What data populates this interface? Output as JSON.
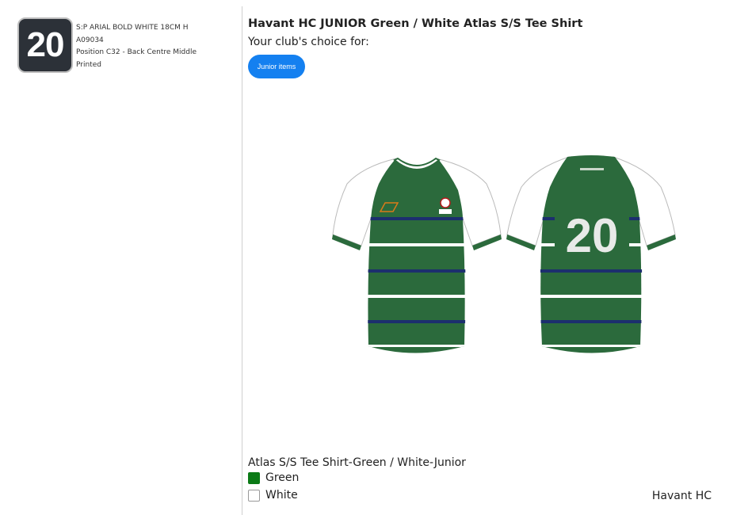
{
  "number_preview": {
    "number": "20",
    "spec_lines": [
      "S:P ARIAL BOLD WHITE 18CM H",
      "A09034",
      "Position C32 - Back Centre Middle",
      "Printed"
    ]
  },
  "product": {
    "title": "Havant HC JUNIOR Green / White Atlas S/S Tee Shirt",
    "subtitle": "Your club's choice for:",
    "category_button": "Junior items",
    "variant_name": "Atlas S/S Tee Shirt-Green / White-Junior",
    "shirt_back_number": "20",
    "colours": [
      {
        "label": "Green",
        "swatch": "#0b7a16"
      },
      {
        "label": "White",
        "swatch": "#ffffff"
      }
    ]
  },
  "club_name": "Havant HC",
  "shirt_colours": {
    "body": "#2b6a3c",
    "sleeve": "#ffffff",
    "trim": "#2b6a3c",
    "navy_stripe": "#1c2f6e",
    "white_stripe": "#ffffff"
  }
}
